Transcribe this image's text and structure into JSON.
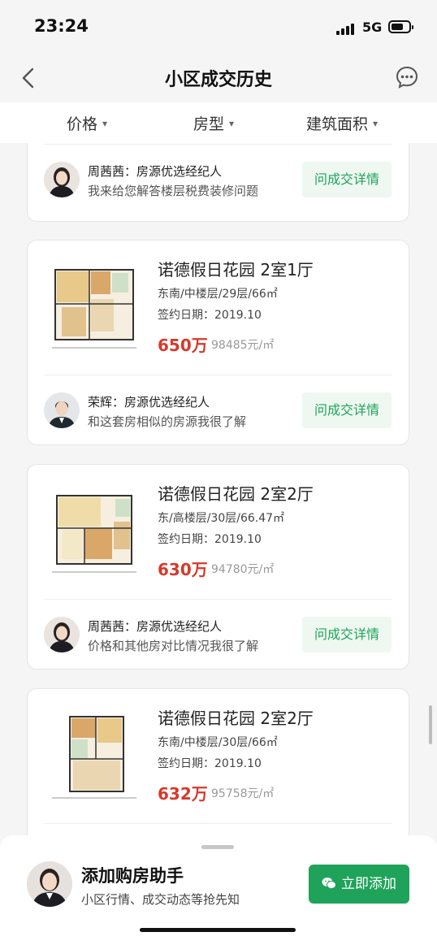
{
  "status": {
    "time": "23:24",
    "network": "5G"
  },
  "nav": {
    "title": "小区成交历史"
  },
  "filters": [
    {
      "label": "价格"
    },
    {
      "label": "房型"
    },
    {
      "label": "建筑面积"
    }
  ],
  "cards": [
    {
      "agent": {
        "name": "周茜茜：房源优选经纪人",
        "desc": "我来给您解答楼层税费装修问题",
        "button": "问成交详情"
      }
    },
    {
      "listing": {
        "title": "诺德假日花园 2室1厅",
        "meta": "东南/中楼层/29层/66㎡",
        "date": "签约日期：2019.10",
        "price": "650万",
        "unit_price": "98485元/㎡"
      },
      "agent": {
        "name": "荣辉：房源优选经纪人",
        "desc": "和这套房相似的房源我很了解",
        "button": "问成交详情"
      }
    },
    {
      "listing": {
        "title": "诺德假日花园 2室2厅",
        "meta": "东/高楼层/30层/66.47㎡",
        "date": "签约日期：2019.10",
        "price": "630万",
        "unit_price": "94780元/㎡"
      },
      "agent": {
        "name": "周茜茜：房源优选经纪人",
        "desc": "价格和其他房对比情况我很了解",
        "button": "问成交详情"
      }
    },
    {
      "listing": {
        "title": "诺德假日花园 2室2厅",
        "meta": "东南/中楼层/30层/66㎡",
        "date": "签约日期：2019.10",
        "price": "632万",
        "unit_price": "95758元/㎡"
      }
    }
  ],
  "banner": {
    "title": "添加购房助手",
    "desc": "小区行情、成交动态等抢先知",
    "button": "立即添加"
  },
  "colors": {
    "accent": "#1fa35a",
    "price": "#d63a2a"
  }
}
